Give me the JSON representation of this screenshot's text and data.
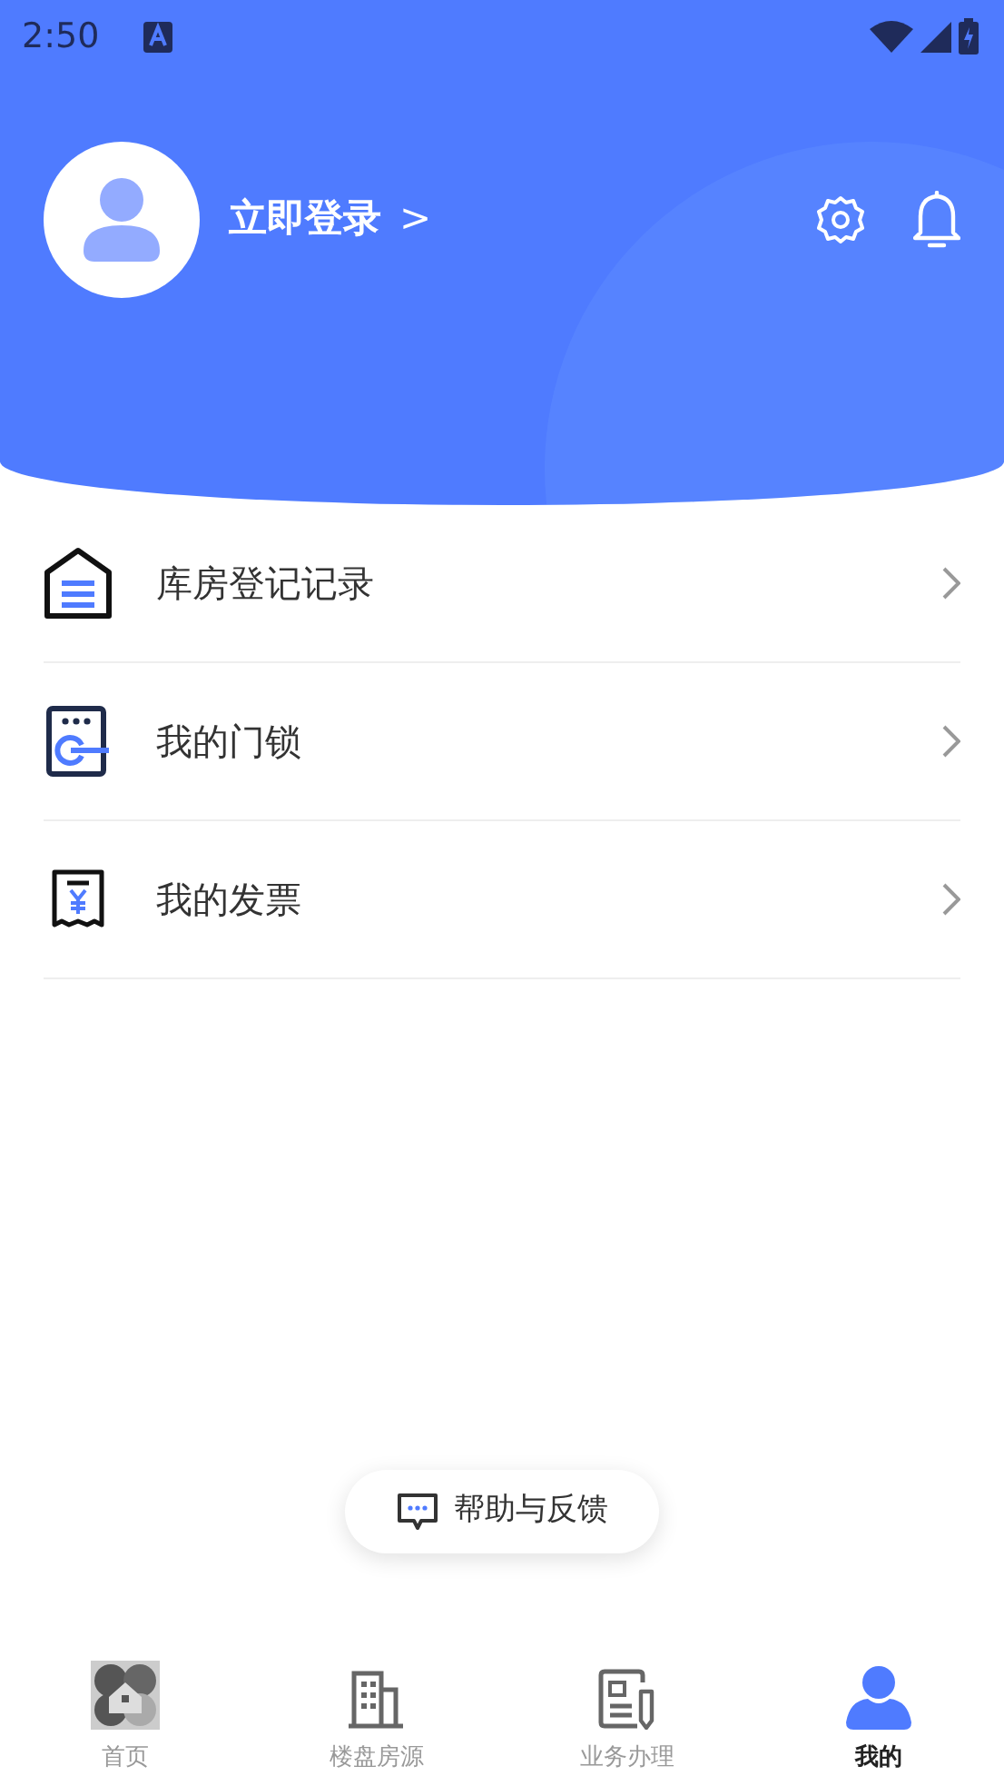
{
  "status_bar": {
    "time": "2:50"
  },
  "profile": {
    "login_label": "立即登录",
    "chevron": ">"
  },
  "menu": [
    {
      "kind": "warehouse",
      "label": "库房登记记录"
    },
    {
      "kind": "lock",
      "label": "我的门锁"
    },
    {
      "kind": "invoice",
      "label": "我的发票"
    }
  ],
  "help_button": {
    "label": "帮助与反馈"
  },
  "tabs": [
    {
      "kind": "home",
      "label": "首页",
      "selected": false
    },
    {
      "kind": "building",
      "label": "楼盘房源",
      "selected": false
    },
    {
      "kind": "business",
      "label": "业务办理",
      "selected": false
    },
    {
      "kind": "me",
      "label": "我的",
      "selected": true
    }
  ]
}
